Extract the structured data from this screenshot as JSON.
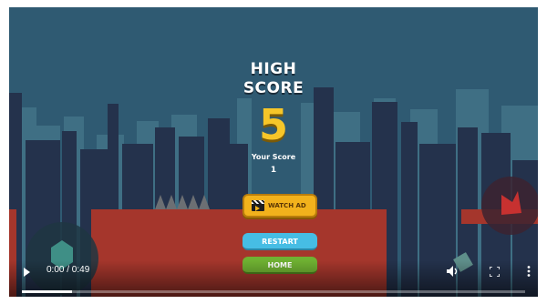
{
  "game": {
    "title_line1": "HIGH",
    "title_line2": "SCORE",
    "high_score": "5",
    "your_score_label": "Your Score",
    "your_score_value": "1"
  },
  "buttons": {
    "watch_ad": "WATCH AD",
    "restart": "RESTART",
    "home": "HOME"
  },
  "video": {
    "time": "0:00 / 0:49",
    "progress_fraction": 0.1
  },
  "colors": {
    "sky": "#2f5a72",
    "score_gold": "#f6c629",
    "watch_ad_bg": "#f2b21c",
    "restart_bg": "#46bde4",
    "home_bg": "#6fb132",
    "brick": "#a5362c"
  },
  "icons": [
    "play-icon",
    "clapperboard-icon",
    "volume-icon",
    "fullscreen-icon",
    "more-options-icon",
    "pause-square-icon",
    "fire-icon"
  ]
}
